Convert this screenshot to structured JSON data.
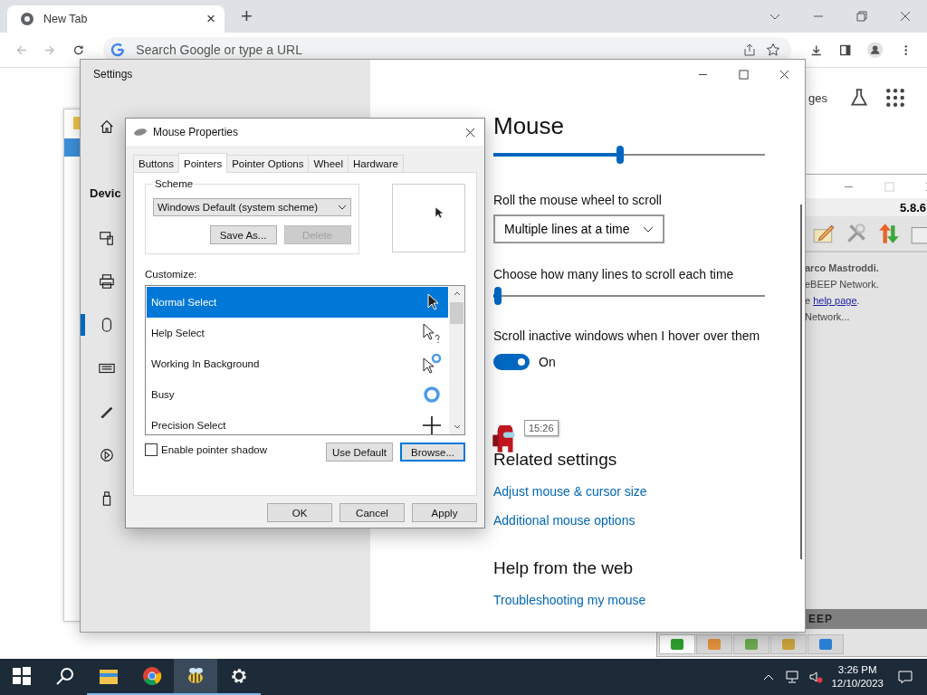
{
  "browser": {
    "tab_title": "New Tab",
    "tab_close": "×",
    "new_tab": "+",
    "address_placeholder": "Search Google or type a URL",
    "page_link": "ges"
  },
  "explorer_window": {
    "selected_row": true
  },
  "bebeep": {
    "version": "5.8.6",
    "lines": [
      {
        "kind": "bold",
        "text": "arco Mastroddi."
      },
      {
        "kind": "plain",
        "text": "eBEEP Network."
      },
      {
        "kind": "link",
        "text": "e ",
        "link": "help page",
        "after": "."
      },
      {
        "kind": "plain",
        "text": "Network..."
      }
    ],
    "banner": "EEP",
    "tabs": [
      {
        "selected": true,
        "color": "#2e9e2e"
      },
      {
        "selected": false,
        "color": "#e0903a"
      },
      {
        "selected": false,
        "color": "#6aa84f"
      },
      {
        "selected": false,
        "color": "#c9a23a"
      },
      {
        "selected": false,
        "color": "#2a7fd4"
      }
    ]
  },
  "settings": {
    "title": "Settings",
    "sidebar_heading": "Devic",
    "sidebar_items": [
      {
        "kind": "home",
        "selected": false
      },
      {
        "kind": "devices",
        "selected": false
      },
      {
        "kind": "printer",
        "selected": false
      },
      {
        "kind": "mouse",
        "selected": true
      },
      {
        "kind": "keyboard",
        "selected": false
      },
      {
        "kind": "pen",
        "selected": false
      },
      {
        "kind": "autoplay",
        "selected": false
      },
      {
        "kind": "usb",
        "selected": false
      }
    ],
    "heading": "Mouse",
    "speed_slider": {
      "level": 0.48
    },
    "wheel_label": "Roll the mouse wheel to scroll",
    "wheel_dropdown": "Multiple lines at a time",
    "lines_label": "Choose how many lines to scroll each time",
    "lines_slider": {
      "level": 0.03
    },
    "inactive_label": "Scroll inactive windows when I hover over them",
    "inactive_toggle": {
      "on": true,
      "label": "On"
    },
    "related_heading": "Related settings",
    "related_links": [
      "Adjust mouse & cursor size",
      "Additional mouse options"
    ],
    "help_heading": "Help from the web",
    "help_links": [
      "Troubleshooting my mouse"
    ]
  },
  "tooltip": "15:26",
  "mouse_properties": {
    "title": "Mouse Properties",
    "tabs": [
      {
        "label": "Buttons",
        "selected": false
      },
      {
        "label": "Pointers",
        "selected": true
      },
      {
        "label": "Pointer Options",
        "selected": false
      },
      {
        "label": "Wheel",
        "selected": false
      },
      {
        "label": "Hardware",
        "selected": false
      }
    ],
    "scheme_label": "Scheme",
    "scheme_value": "Windows Default (system scheme)",
    "scheme_buttons": [
      {
        "label": "Save As...",
        "disabled": false
      },
      {
        "label": "Delete",
        "disabled": true
      }
    ],
    "customize_label": "Customize:",
    "cursors": [
      {
        "name": "Normal Select",
        "kind": "normal",
        "selected": true
      },
      {
        "name": "Help Select",
        "kind": "help",
        "selected": false
      },
      {
        "name": "Working In Background",
        "kind": "working",
        "selected": false
      },
      {
        "name": "Busy",
        "kind": "busy",
        "selected": false
      },
      {
        "name": "Precision Select",
        "kind": "precision",
        "selected": false
      }
    ],
    "shadow_checkbox": {
      "label": "Enable pointer shadow",
      "checked": false
    },
    "list_buttons": [
      {
        "label": "Use Default",
        "focused": false
      },
      {
        "label": "Browse...",
        "focused": true
      }
    ],
    "buttons": [
      "OK",
      "Cancel",
      "Apply"
    ]
  },
  "taskbar": {
    "apps": [
      {
        "kind": "start",
        "running": false,
        "selected": false
      },
      {
        "kind": "search",
        "running": false,
        "selected": false
      },
      {
        "kind": "explorer",
        "running": true,
        "selected": false
      },
      {
        "kind": "chrome",
        "running": true,
        "selected": false
      },
      {
        "kind": "bee",
        "running": true,
        "selected": true
      },
      {
        "kind": "gear",
        "running": true,
        "selected": false
      }
    ],
    "time": "3:26 PM",
    "date": "12/10/2023"
  }
}
